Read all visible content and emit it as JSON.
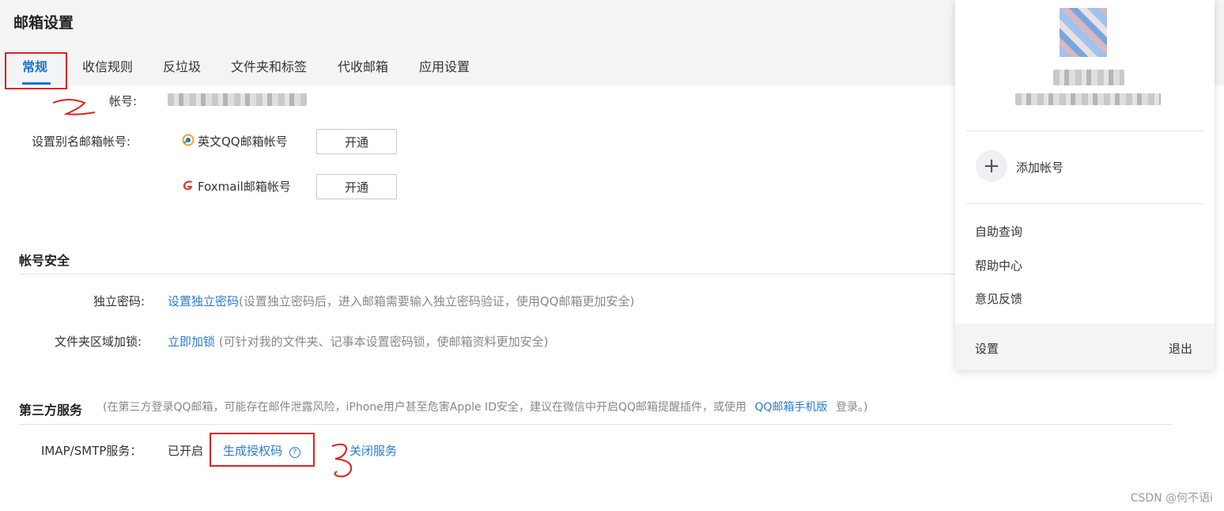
{
  "header": {
    "title": "邮箱设置",
    "tabs": [
      {
        "label": "常规"
      },
      {
        "label": "收信规则"
      },
      {
        "label": "反垃圾"
      },
      {
        "label": "文件夹和标签"
      },
      {
        "label": "代收邮箱"
      },
      {
        "label": "应用设置"
      }
    ]
  },
  "account": {
    "label": "帐号:",
    "value_redacted": true
  },
  "alias": {
    "label": "设置别名邮箱帐号:",
    "options": [
      {
        "name": "英文QQ邮箱帐号",
        "button": "开通",
        "icon": "qq-mail-icon"
      },
      {
        "name": "Foxmail邮箱帐号",
        "button": "开通",
        "icon": "foxmail-icon"
      }
    ]
  },
  "security": {
    "title": "帐号安全",
    "independent_password": {
      "label": "独立密码:",
      "link": "设置独立密码",
      "desc": "(设置独立密码后，进入邮箱需要输入独立密码验证，使用QQ邮箱更加安全)"
    },
    "folder_lock": {
      "label": "文件夹区域加锁:",
      "link": "立即加锁",
      "desc": " (可针对我的文件夹、记事本设置密码锁，使邮箱资料更加安全)"
    }
  },
  "third_party": {
    "title": "第三方服务",
    "note_prefix": "(在第三方登录QQ邮箱，可能存在邮件泄露风险，iPhone用户甚至危害Apple ID安全，建议在微信中开启QQ邮箱提醒插件，或使用",
    "note_link": "QQ邮箱手机版",
    "note_suffix": "登录。)",
    "imap": {
      "label": "IMAP/SMTP服务：",
      "status": "已开启",
      "generate_link": "生成授权码",
      "help_icon": "question-circle-icon",
      "close_link": "关闭服务"
    }
  },
  "panel": {
    "add_account": "添加帐号",
    "menu": [
      "自助查询",
      "帮助中心",
      "意见反馈"
    ],
    "settings": "设置",
    "logout": "退出"
  },
  "annotations": {
    "red_color": "#e02020",
    "marks": [
      "1",
      "2",
      "3"
    ]
  },
  "watermark": "CSDN @何不语i",
  "colors": {
    "accent": "#1a73d9",
    "link": "#2a7bd3",
    "highlight": "#e02020"
  }
}
